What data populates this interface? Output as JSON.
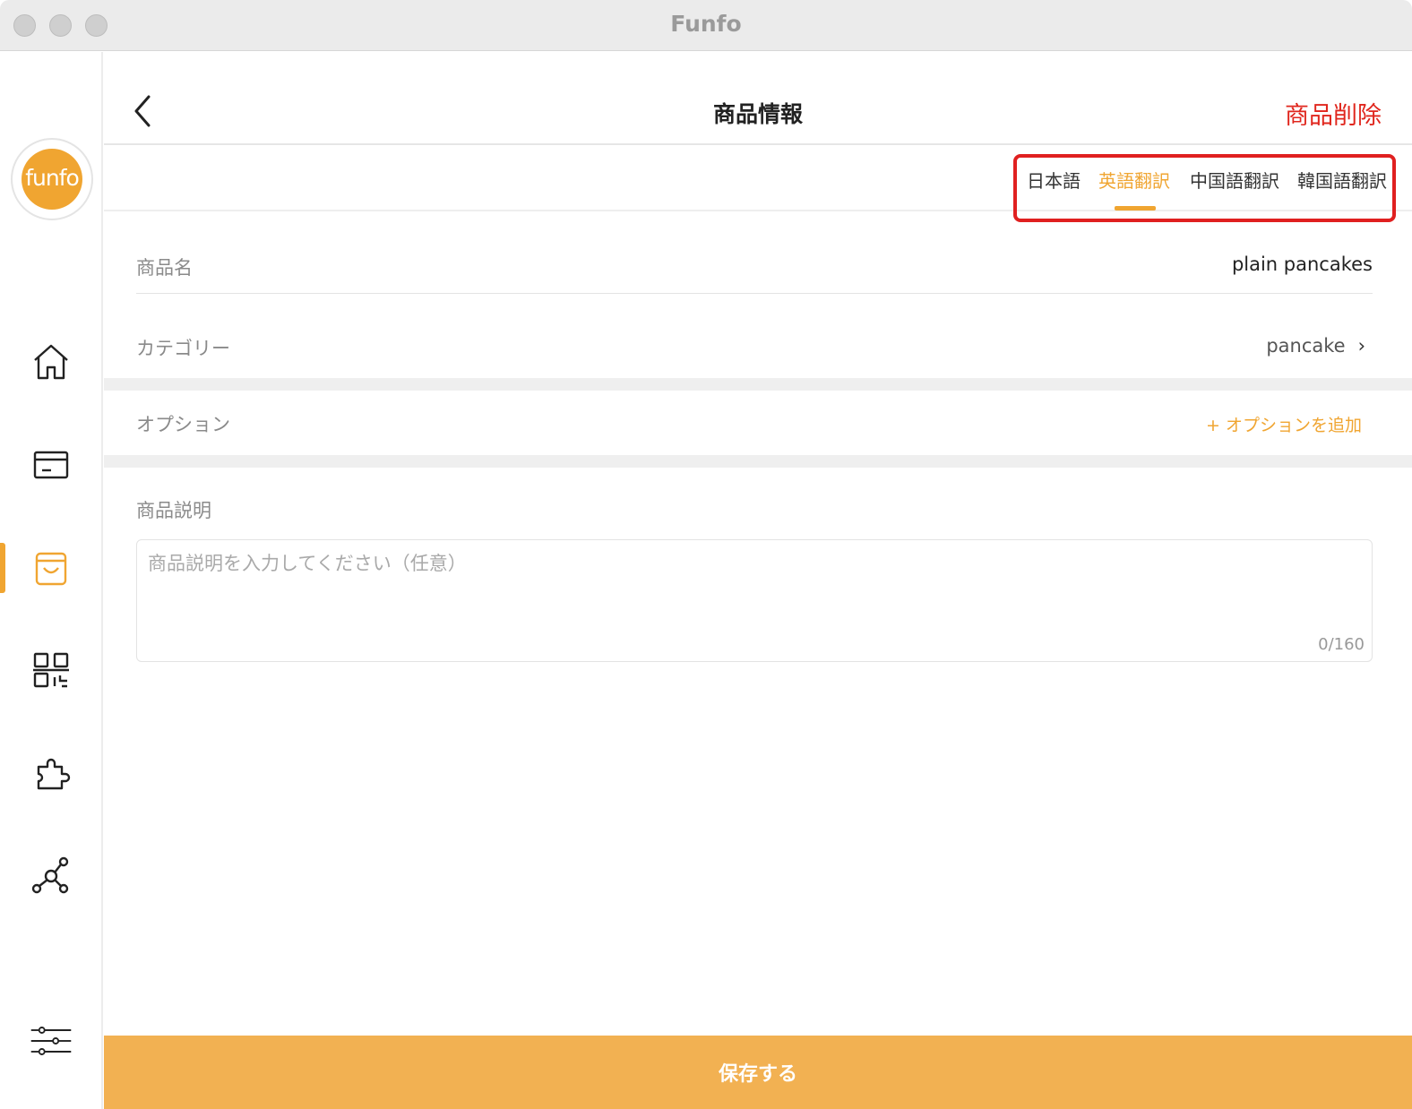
{
  "window": {
    "title": "Funfo"
  },
  "sidebar": {
    "logo_text": "funfo",
    "items": [
      {
        "name": "home",
        "icon": "home-icon"
      },
      {
        "name": "orders",
        "icon": "card-icon"
      },
      {
        "name": "products",
        "icon": "shopping-bag-icon",
        "active": true
      },
      {
        "name": "qr",
        "icon": "qr-code-icon"
      },
      {
        "name": "plugins",
        "icon": "puzzle-icon"
      },
      {
        "name": "network",
        "icon": "network-icon"
      },
      {
        "name": "settings",
        "icon": "sliders-icon"
      }
    ]
  },
  "header": {
    "title": "商品情報",
    "delete_label": "商品削除"
  },
  "tabs": [
    {
      "label": "日本語",
      "active": false
    },
    {
      "label": "英語翻訳",
      "active": true
    },
    {
      "label": "中国語翻訳",
      "active": false
    },
    {
      "label": "韓国語翻訳",
      "active": false
    }
  ],
  "form": {
    "name_label": "商品名",
    "name_value": "plain pancakes",
    "category_label": "カテゴリー",
    "category_value": "pancake",
    "option_label": "オプション",
    "add_option_label": "+ オプションを追加",
    "description_label": "商品説明",
    "description_placeholder": "商品説明を入力してください（任意）",
    "description_counter": "0/160"
  },
  "footer": {
    "save_label": "保存する"
  },
  "colors": {
    "accent": "#f0a531",
    "danger": "#e0261d",
    "highlight": "#e02020"
  }
}
